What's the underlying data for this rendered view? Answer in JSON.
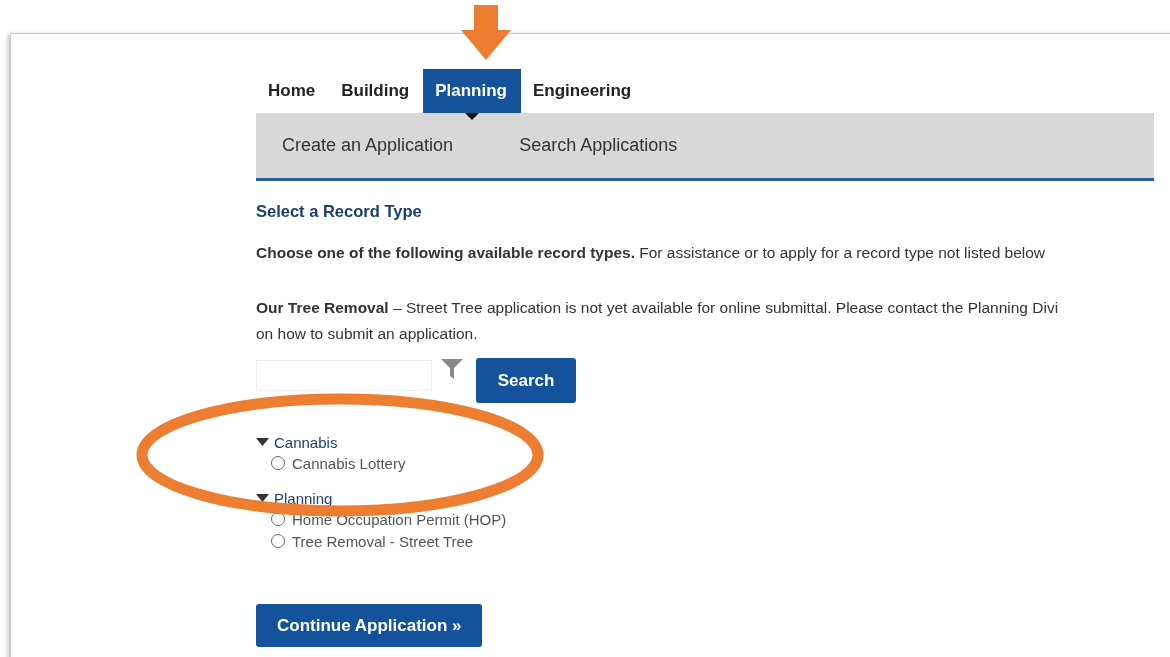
{
  "nav_tabs": [
    {
      "label": "Home",
      "selected": false
    },
    {
      "label": "Building",
      "selected": false
    },
    {
      "label": "Planning",
      "selected": true
    },
    {
      "label": "Engineering",
      "selected": false
    }
  ],
  "sub_nav": [
    {
      "label": "Create an Application"
    },
    {
      "label": "Search Applications"
    }
  ],
  "heading": "Select a Record Type",
  "intro": "**Choose one of the following available record types.** For assistance or to apply for a record type not listed below",
  "notice_lines": [
    "**Our Tree Removal** – Street Tree application is not yet available for online submittal. Please contact the Planning Divi",
    "on how to submit an application."
  ],
  "search": {
    "button": "Search"
  },
  "record_groups": [
    {
      "label": "Cannabis",
      "expanded": true,
      "children": [
        {
          "label": "Cannabis Lottery",
          "selected": false
        }
      ]
    },
    {
      "label": "Planning",
      "expanded": true,
      "children": [
        {
          "label": "Home Occupation Permit (HOP)",
          "selected": false
        },
        {
          "label": "Tree Removal - Street Tree",
          "selected": false
        }
      ]
    }
  ],
  "continue_button": "Continue Application »"
}
